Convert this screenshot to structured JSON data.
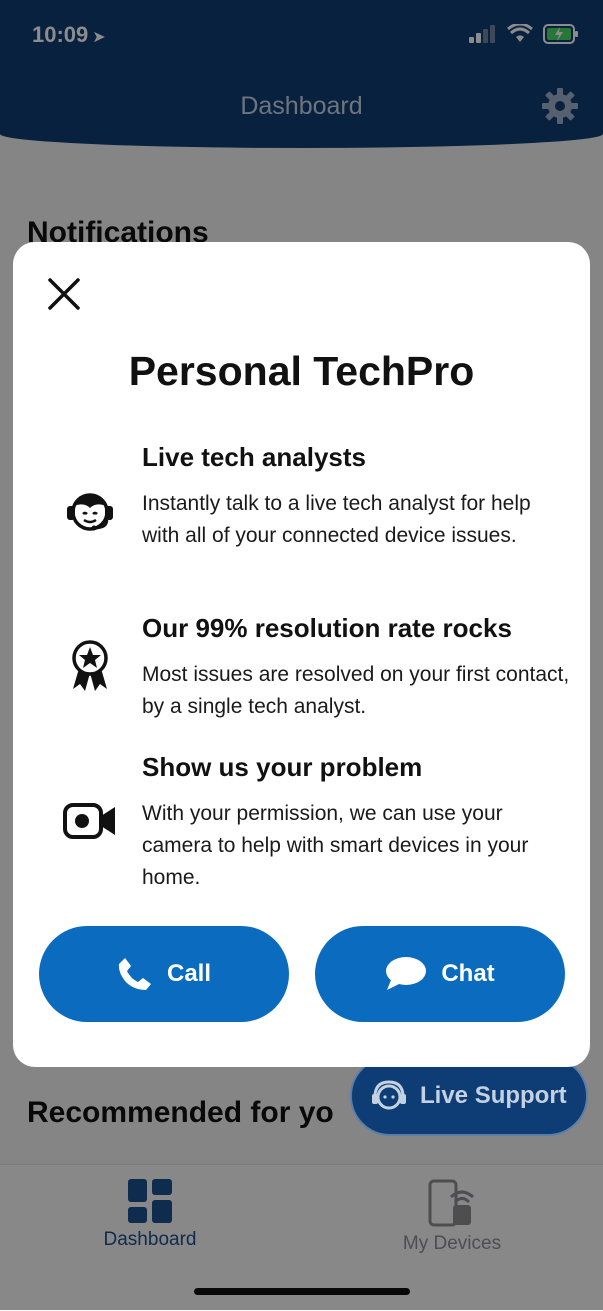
{
  "status_bar": {
    "time": "10:09"
  },
  "header": {
    "title": "Dashboard"
  },
  "background": {
    "notifications_title": "Notifications",
    "recommended_title": "Recommended for yo"
  },
  "live_support": {
    "label": "Live Support"
  },
  "modal": {
    "title": "Personal TechPro",
    "features": [
      {
        "icon": "headset-agent-icon",
        "heading": "Live tech analysts",
        "body": "Instantly talk to a live tech analyst for help with all of your connected device issues."
      },
      {
        "icon": "award-ribbon-icon",
        "heading": "Our 99% resolution rate rocks",
        "body": "Most issues are resolved on your first contact, by a single tech analyst."
      },
      {
        "icon": "video-camera-icon",
        "heading": "Show us your problem",
        "body": "With your permission, we can use your camera to help with smart devices in your home."
      }
    ],
    "buttons": {
      "call": "Call",
      "chat": "Chat"
    }
  },
  "tabs": [
    {
      "label": "Dashboard",
      "icon": "dashboard-grid-icon",
      "active": true
    },
    {
      "label": "My Devices",
      "icon": "devices-icon",
      "active": false
    }
  ],
  "colors": {
    "header": "#0e3c74",
    "button": "#0b6cbf",
    "active_tab": "#1c4f8c",
    "inactive_tab": "#8e8e93"
  }
}
